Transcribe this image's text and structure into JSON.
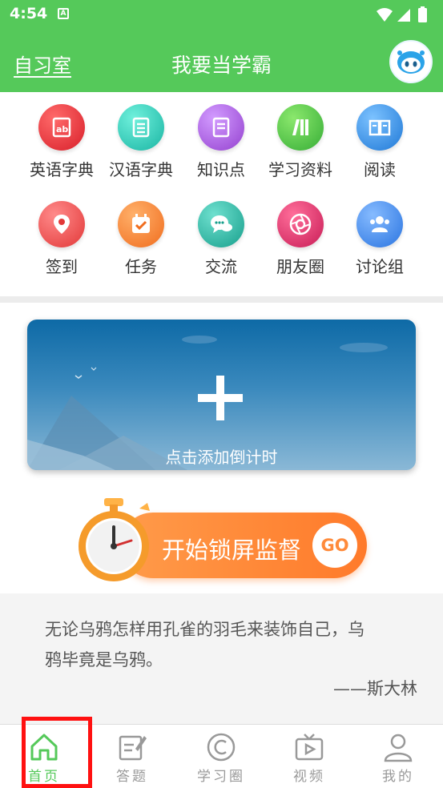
{
  "status_bar": {
    "time": "4:54",
    "notification_icon": "A"
  },
  "header": {
    "left_link": "自习室",
    "title": "我要当学霸",
    "avatar_icon": "robot-avatar-icon"
  },
  "grid": {
    "items": [
      {
        "label": "英语字典",
        "icon": "english-dictionary-icon",
        "color": "#e8333a"
      },
      {
        "label": "汉语字典",
        "icon": "chinese-dictionary-icon",
        "color": "#2bcbb8"
      },
      {
        "label": "知识点",
        "icon": "knowledge-icon",
        "color": "#a55fd6"
      },
      {
        "label": "学习资料",
        "icon": "study-materials-icon",
        "color": "#4fc44f"
      },
      {
        "label": "阅读",
        "icon": "book-icon",
        "color": "#2f8ee5"
      },
      {
        "label": "签到",
        "icon": "location-pin-icon",
        "color": "#f04a4a"
      },
      {
        "label": "任务",
        "icon": "calendar-task-icon",
        "color": "#f57b2a"
      },
      {
        "label": "交流",
        "icon": "chat-icon",
        "color": "#2ab7a1"
      },
      {
        "label": "朋友圈",
        "icon": "camera-aperture-icon",
        "color": "#e0336b"
      },
      {
        "label": "讨论组",
        "icon": "group-icon",
        "color": "#3d8ff0"
      }
    ]
  },
  "timer_card": {
    "label": "点击添加倒计时"
  },
  "lock_button": {
    "label": "开始锁屏监督",
    "go_label": "GO"
  },
  "quote": {
    "text": "无论乌鸦怎样用孔雀的羽毛来装饰自己，乌鸦毕竟是乌鸦。",
    "author": "——斯大林"
  },
  "bottom_nav": {
    "items": [
      {
        "label": "首页",
        "icon": "home-icon",
        "active": true
      },
      {
        "label": "答题",
        "icon": "edit-icon",
        "active": false
      },
      {
        "label": "学习圈",
        "icon": "copyright-circle-icon",
        "active": false
      },
      {
        "label": "视频",
        "icon": "tv-play-icon",
        "active": false
      },
      {
        "label": "我的",
        "icon": "user-icon",
        "active": false
      }
    ],
    "active_color": "#55c95a",
    "inactive_color": "#999999"
  },
  "colors": {
    "primary": "#55c95a",
    "accent_orange": "#ff8a3a"
  }
}
